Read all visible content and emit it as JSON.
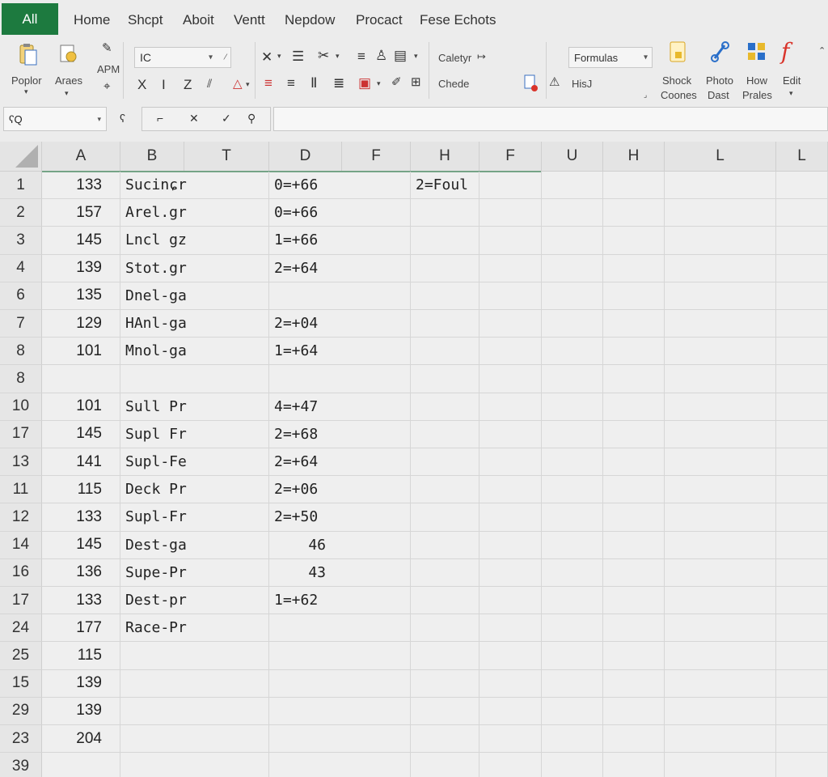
{
  "tabs": {
    "active": "All",
    "items": [
      "Home",
      "Shcpt",
      "Aboit",
      "Ventt",
      "Nepdow",
      "Procact",
      "Fese Echots"
    ]
  },
  "ribbon": {
    "paste_label": "Poplor",
    "arrange_label": "Araes",
    "apm_label": "APM",
    "font_box": "IC",
    "font_row2": [
      "X",
      "I",
      "Z"
    ],
    "category_label": "Caletyr",
    "check_label": "Chede",
    "formulas_box": "Formulas",
    "his_label": "HisJ",
    "big_buttons": [
      {
        "line1": "Shock",
        "line2": "Coones"
      },
      {
        "line1": "Photo",
        "line2": "Dast"
      },
      {
        "line1": "How",
        "line2": "Prales"
      },
      {
        "line1": "Edit",
        "line2": ""
      }
    ],
    "accent_colors": {
      "tab_green": "#1d7a3f",
      "edit_red": "#d9342b",
      "blue": "#2a6fc9",
      "yellow": "#e8b92c"
    }
  },
  "formula_bar": {
    "name_box": "ʕQ",
    "fx_symbol": "ʕ"
  },
  "grid": {
    "columns": [
      "A",
      "B",
      "T",
      "D",
      "F",
      "H",
      "F",
      "U",
      "H",
      "L",
      "L"
    ],
    "rows": [
      {
        "num": "1",
        "a": "133",
        "b": "Sucinɕr",
        "d": "0=+66",
        "h": "2=Foul"
      },
      {
        "num": "2",
        "a": "157",
        "b": "Arel.gr",
        "d": "0=+66",
        "h": ""
      },
      {
        "num": "3",
        "a": "145",
        "b": "Lncl gz",
        "d": "1=+66",
        "h": ""
      },
      {
        "num": "4",
        "a": "139",
        "b": "Stot.gr",
        "d": "2=+64",
        "h": ""
      },
      {
        "num": "6",
        "a": "135",
        "b": "Dnel-ga",
        "d": "",
        "h": ""
      },
      {
        "num": "7",
        "a": "129",
        "b": "HAnl-ga",
        "d": "2=+04",
        "h": ""
      },
      {
        "num": "8",
        "a": "101",
        "b": "Mnol-ga",
        "d": "1=+64",
        "h": ""
      },
      {
        "num": "8",
        "a": "",
        "b": "",
        "d": "",
        "h": ""
      },
      {
        "num": "10",
        "a": "101",
        "b": "Sull Pr",
        "d": "4=+47",
        "h": ""
      },
      {
        "num": "17",
        "a": "145",
        "b": "Supl Fr",
        "d": "2=+68",
        "h": ""
      },
      {
        "num": "13",
        "a": "141",
        "b": "Supl-Fe",
        "d": "2=+64",
        "h": ""
      },
      {
        "num": "11",
        "a": "115",
        "b": "Deck Pr",
        "d": "2=+06",
        "h": ""
      },
      {
        "num": "12",
        "a": "133",
        "b": "Supl-Fr",
        "d": "2=+50",
        "h": ""
      },
      {
        "num": "14",
        "a": "145",
        "b": "Dest-ga",
        "d": "46",
        "h": ""
      },
      {
        "num": "16",
        "a": "136",
        "b": "Supe-Pr",
        "d": "43",
        "h": ""
      },
      {
        "num": "17",
        "a": "133",
        "b": "Dest-pr",
        "d": "1=+62",
        "h": ""
      },
      {
        "num": "24",
        "a": "177",
        "b": "Race-Pr",
        "d": "",
        "h": ""
      },
      {
        "num": "25",
        "a": "115",
        "b": "",
        "d": "",
        "h": ""
      },
      {
        "num": "15",
        "a": "139",
        "b": "",
        "d": "",
        "h": ""
      },
      {
        "num": "29",
        "a": "139",
        "b": "",
        "d": "",
        "h": ""
      },
      {
        "num": "23",
        "a": "204",
        "b": "",
        "d": "",
        "h": ""
      },
      {
        "num": "39",
        "a": "",
        "b": "",
        "d": "",
        "h": ""
      }
    ]
  }
}
